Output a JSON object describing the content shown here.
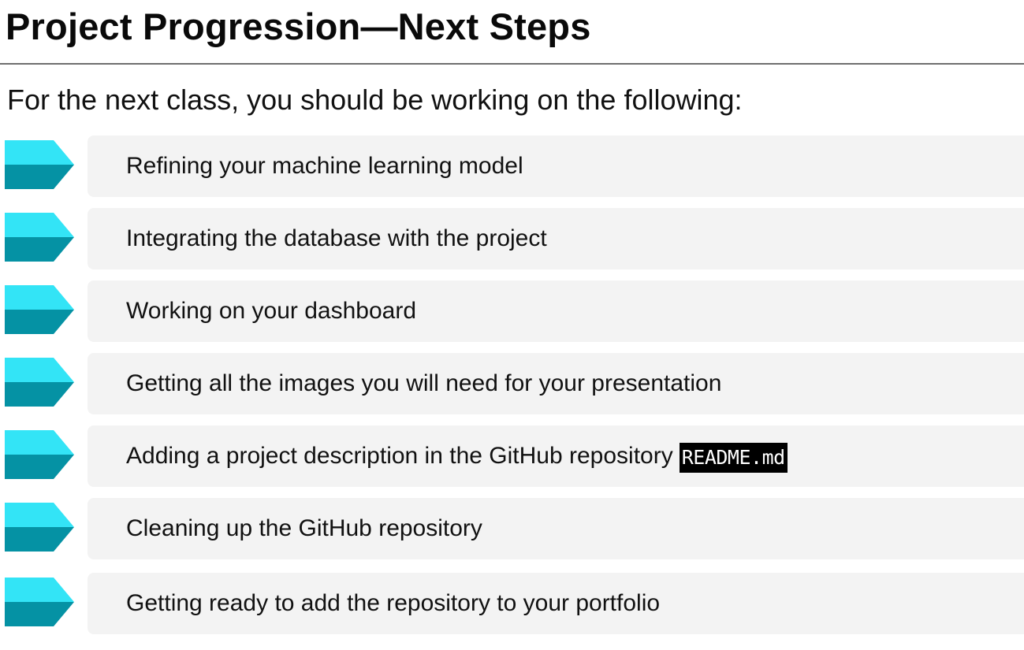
{
  "slide": {
    "title": "Project Progression—Next Steps",
    "subtitle": "For the next class, you should be working on the following:"
  },
  "colors": {
    "arrow_top": "#33e4f6",
    "arrow_bottom": "#0592a4",
    "bar_background": "#f3f3f3",
    "rule": "#6e6e6e",
    "code_background": "#000000",
    "code_text": "#ffffff"
  },
  "icons": {
    "item_marker": "chevron-arrow-icon"
  },
  "items": [
    {
      "text": "Refining your machine learning model",
      "code": ""
    },
    {
      "text": "Integrating the database with the project",
      "code": ""
    },
    {
      "text": "Working on your dashboard",
      "code": ""
    },
    {
      "text": "Getting all the images you will need for your presentation",
      "code": ""
    },
    {
      "text": "Adding a project description in the GitHub repository",
      "code": "README.md"
    },
    {
      "text": "Cleaning up the GitHub repository",
      "code": ""
    },
    {
      "text": "Getting ready to add the repository to your portfolio",
      "code": ""
    }
  ]
}
